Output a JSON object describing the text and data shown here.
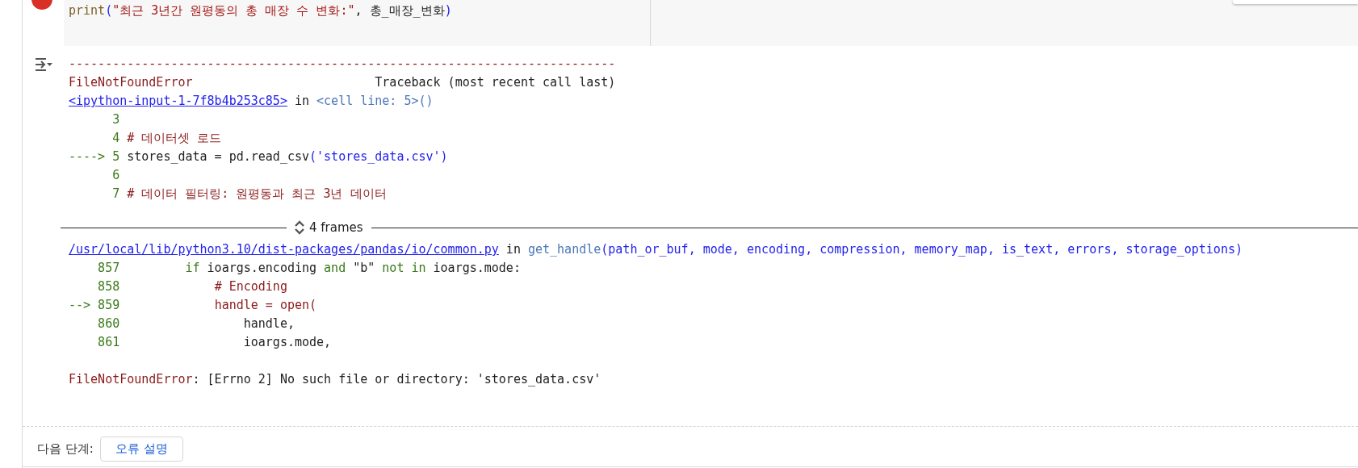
{
  "code_cell": {
    "lines": [
      [
        {
          "kind": "func",
          "text": "print"
        },
        {
          "kind": "paren",
          "text": "("
        },
        {
          "kind": "str",
          "text": "\"최근 3년간 원평동의 총 매장 수 변화:\""
        },
        {
          "kind": "plain",
          "text": ", 총_매장_변화"
        },
        {
          "kind": "paren",
          "text": ")"
        }
      ]
    ]
  },
  "output": {
    "lines": [
      [
        {
          "kind": "err",
          "text": "---------------------------------------------------------------------------"
        }
      ],
      [
        {
          "kind": "err",
          "text": "FileNotFoundError"
        },
        {
          "kind": "plain",
          "text": "                         Traceback (most recent call last)"
        }
      ],
      [
        {
          "kind": "link",
          "text": "<ipython-input-1-7f8b4b253c85>"
        },
        {
          "kind": "plain",
          "text": " in "
        },
        {
          "kind": "func2",
          "text": "<cell line: 5>()"
        }
      ],
      [
        {
          "kind": "num",
          "text": "      3"
        }
      ],
      [
        {
          "kind": "num",
          "text": "      4 "
        },
        {
          "kind": "cmt",
          "text": "# 데이터셋 로드"
        }
      ],
      [
        {
          "kind": "num",
          "text": "----> 5 "
        },
        {
          "kind": "plain",
          "text": "stores_data = pd.read_csv"
        },
        {
          "kind": "paren",
          "text": "("
        },
        {
          "kind": "str2",
          "text": "'stores_data.csv'"
        },
        {
          "kind": "paren",
          "text": ")"
        }
      ],
      [
        {
          "kind": "num",
          "text": "      6"
        }
      ],
      [
        {
          "kind": "num",
          "text": "      7 "
        },
        {
          "kind": "cmt",
          "text": "# 데이터 필터링: 원평동과 최근 3년 데이터"
        }
      ]
    ],
    "frames": {
      "label": "4 frames",
      "expanded": false
    },
    "frame_lines": [
      [
        {
          "kind": "link",
          "text": "/usr/local/lib/python3.10/dist-packages/pandas/io/common.py"
        },
        {
          "kind": "plain",
          "text": " in "
        },
        {
          "kind": "func2",
          "text": "get_handle"
        },
        {
          "kind": "paren",
          "text": "(path_or_buf, mode, encoding, compression, memory_map, is_text, errors, storage_options)"
        }
      ],
      [
        {
          "kind": "num",
          "text": "    857         "
        },
        {
          "kind": "kw",
          "text": "if"
        },
        {
          "kind": "plain",
          "text": " ioargs.encoding "
        },
        {
          "kind": "kw",
          "text": "and"
        },
        {
          "kind": "plain",
          "text": " \"b\" "
        },
        {
          "kind": "kw",
          "text": "not in"
        },
        {
          "kind": "plain",
          "text": " ioargs.mode:"
        }
      ],
      [
        {
          "kind": "num",
          "text": "    858             "
        },
        {
          "kind": "cmt",
          "text": "# Encoding"
        }
      ],
      [
        {
          "kind": "num",
          "text": "--> 859             "
        },
        {
          "kind": "cmt",
          "text": "handle = open("
        }
      ],
      [
        {
          "kind": "num",
          "text": "    860                 "
        },
        {
          "kind": "plain",
          "text": "handle,"
        }
      ],
      [
        {
          "kind": "num",
          "text": "    861                 "
        },
        {
          "kind": "plain",
          "text": "ioargs.mode,"
        }
      ]
    ],
    "error_line": [
      {
        "kind": "err",
        "text": "FileNotFoundError"
      },
      {
        "kind": "plain",
        "text": ": [Errno 2] No such file or directory: 'stores_data.csv'"
      }
    ]
  },
  "next_steps": {
    "label": "다음 단계:",
    "button": "오류 설명"
  }
}
